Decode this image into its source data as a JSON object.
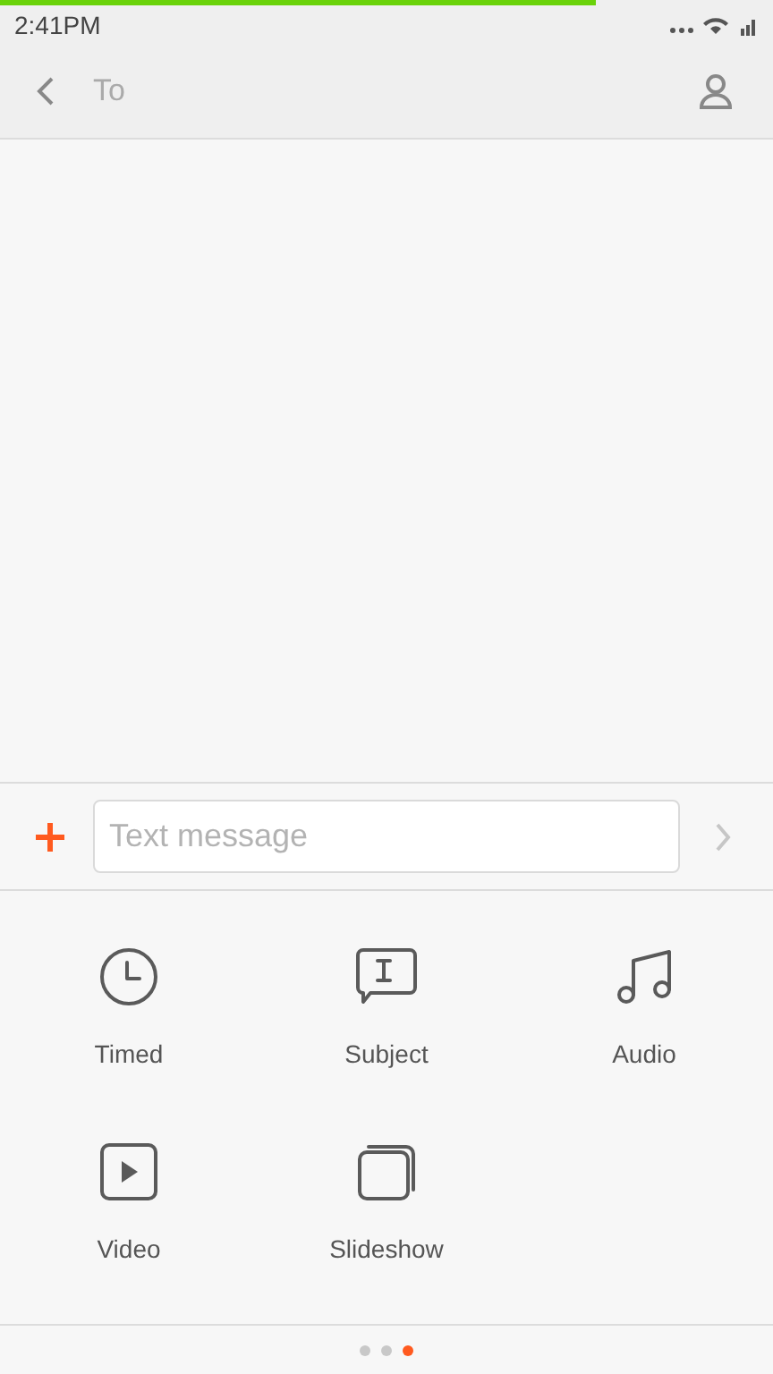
{
  "status_bar": {
    "time": "2:41PM"
  },
  "progress": {
    "level": 0.77
  },
  "header": {
    "title": "To"
  },
  "composer": {
    "placeholder": "Text message"
  },
  "attachments": [
    {
      "kind": "timed",
      "label": "Timed"
    },
    {
      "kind": "subject",
      "label": "Subject"
    },
    {
      "kind": "audio",
      "label": "Audio"
    },
    {
      "kind": "video",
      "label": "Video"
    },
    {
      "kind": "slideshow",
      "label": "Slideshow"
    }
  ],
  "pages": [
    {
      "selected": false
    },
    {
      "selected": false
    },
    {
      "selected": true
    }
  ]
}
